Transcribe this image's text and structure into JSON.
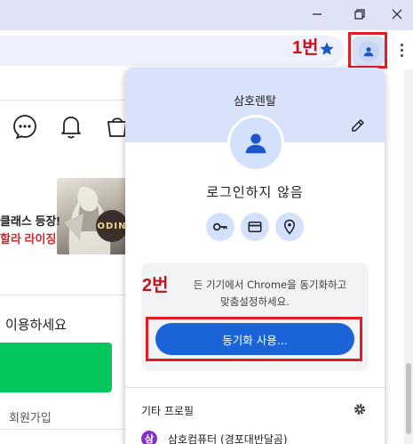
{
  "window": {
    "minimize_icon": "minimize-icon",
    "restore_icon": "restore-icon",
    "close_icon": "close-icon",
    "restore_label": "⧉",
    "close_label": "✕"
  },
  "toolbar": {
    "bookmark_icon": "star-icon",
    "profile_icon": "person-icon",
    "menu_icon": "kebab-menu-icon"
  },
  "annotations": {
    "step1": "1번",
    "step2": "2번",
    "color": "#e21c23"
  },
  "background_page": {
    "banner_line1": "클래스 등장!",
    "banner_line2": "할라 라이징",
    "banner_logo": "ODIN",
    "login_prompt": "이용하세요",
    "signup_link": "회원가입",
    "icons": [
      "chat-icon",
      "bell-icon",
      "shopping-bag-icon"
    ],
    "login_button_color": "#03c75a"
  },
  "profile_popup": {
    "account_name": "삼호렌탈",
    "status": "로그인하지 않음",
    "quick_actions": [
      {
        "icon": "key-icon",
        "label": "passwords"
      },
      {
        "icon": "credit-card-icon",
        "label": "payment methods"
      },
      {
        "icon": "location-pin-icon",
        "label": "addresses"
      }
    ],
    "sync_description_line1": "기기에서 Chrome을 동기화하고",
    "sync_description_line1_prefix": "든",
    "sync_description_line2": "맞춤설정하세요.",
    "sync_button": "동기화 사용...",
    "other_profiles_label": "기타 프로필",
    "other_profile": {
      "initial": "삼",
      "name": "삼호컴퓨터 (경포대반달곰)"
    },
    "accent_color": "#1a64d8",
    "header_color": "#d8e3fb"
  }
}
